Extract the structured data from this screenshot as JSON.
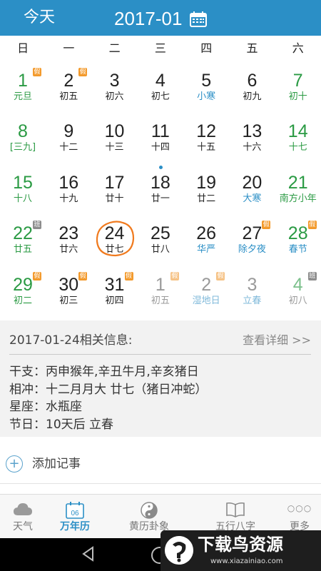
{
  "header": {
    "today_label": "今天",
    "month": "2017-01",
    "calendar_icon": "calendar-icon"
  },
  "weekdays": [
    "日",
    "一",
    "二",
    "三",
    "四",
    "五",
    "六"
  ],
  "colors": {
    "accent": "#2b8fc6",
    "green": "#2a9a43",
    "rest_badge": "#f39a2c",
    "work_badge": "#8d8d8d"
  },
  "calendar": {
    "selected_day": "24",
    "weeks": [
      [
        {
          "day": "1",
          "lunar": "元旦",
          "style": "green",
          "lunar_style": "green",
          "badge": "假",
          "badge_type": "rest"
        },
        {
          "day": "2",
          "lunar": "初五",
          "badge": "假",
          "badge_type": "rest"
        },
        {
          "day": "3",
          "lunar": "初六"
        },
        {
          "day": "4",
          "lunar": "初七"
        },
        {
          "day": "5",
          "lunar": "小寒",
          "lunar_style": "blue"
        },
        {
          "day": "6",
          "lunar": "初九"
        },
        {
          "day": "7",
          "lunar": "初十",
          "style": "green",
          "lunar_style": "green"
        }
      ],
      [
        {
          "day": "8",
          "lunar": "[三九]",
          "style": "green",
          "lunar_style": "green"
        },
        {
          "day": "9",
          "lunar": "十二"
        },
        {
          "day": "10",
          "lunar": "十三"
        },
        {
          "day": "11",
          "lunar": "十四"
        },
        {
          "day": "12",
          "lunar": "十五"
        },
        {
          "day": "13",
          "lunar": "十六"
        },
        {
          "day": "14",
          "lunar": "十七",
          "style": "green",
          "lunar_style": "green"
        }
      ],
      [
        {
          "day": "15",
          "lunar": "十八",
          "style": "green",
          "lunar_style": "green"
        },
        {
          "day": "16",
          "lunar": "十九"
        },
        {
          "day": "17",
          "lunar": "廿十"
        },
        {
          "day": "18",
          "lunar": "廿一",
          "dot": true
        },
        {
          "day": "19",
          "lunar": "廿二"
        },
        {
          "day": "20",
          "lunar": "大寒",
          "lunar_style": "blue"
        },
        {
          "day": "21",
          "lunar": "南方小年",
          "style": "green",
          "lunar_style": "green"
        }
      ],
      [
        {
          "day": "22",
          "lunar": "廿五",
          "style": "green",
          "lunar_style": "green",
          "badge": "班",
          "badge_type": "work"
        },
        {
          "day": "23",
          "lunar": "廿六"
        },
        {
          "day": "24",
          "lunar": "廿七",
          "today": true
        },
        {
          "day": "25",
          "lunar": "廿八"
        },
        {
          "day": "26",
          "lunar": "华严",
          "lunar_style": "blue"
        },
        {
          "day": "27",
          "lunar": "除夕夜",
          "lunar_style": "blue",
          "badge": "假",
          "badge_type": "rest"
        },
        {
          "day": "28",
          "lunar": "春节",
          "style": "green",
          "lunar_style": "blue",
          "badge": "假",
          "badge_type": "rest"
        }
      ],
      [
        {
          "day": "29",
          "lunar": "初二",
          "style": "green",
          "lunar_style": "green",
          "badge": "假",
          "badge_type": "rest"
        },
        {
          "day": "30",
          "lunar": "初三",
          "badge": "假",
          "badge_type": "rest"
        },
        {
          "day": "31",
          "lunar": "初四",
          "badge": "假",
          "badge_type": "rest"
        },
        {
          "day": "1",
          "lunar": "初五",
          "style": "faded",
          "lunar_style": "faded",
          "badge": "假",
          "badge_type": "rest faded"
        },
        {
          "day": "2",
          "lunar": "湿地日",
          "style": "faded",
          "lunar_style": "faded-blue",
          "badge": "假",
          "badge_type": "rest faded"
        },
        {
          "day": "3",
          "lunar": "立春",
          "style": "faded",
          "lunar_style": "faded-blue"
        },
        {
          "day": "4",
          "lunar": "初八",
          "style": "faded-green",
          "lunar_style": "faded",
          "badge": "班",
          "badge_type": "work"
        }
      ]
    ]
  },
  "info": {
    "title": "2017-01-24相关信息:",
    "more": "查看详细 >>",
    "rows": [
      "干支：丙申猴年,辛丑牛月,辛亥猪日",
      "相冲：十二月月大 廿七（猪日冲蛇）",
      "星座：水瓶座",
      "节日：10天后 立春"
    ]
  },
  "add_note": {
    "icon": "+",
    "label": "添加记事"
  },
  "tabs": [
    {
      "label": "天气",
      "icon": "cloud-icon"
    },
    {
      "label": "万年历",
      "icon": "calendar-06-icon",
      "icon_text": "06",
      "active": true
    },
    {
      "label": "黄历卦象",
      "icon": "yin-yang-icon"
    },
    {
      "label": "五行八字",
      "icon": "book-icon"
    },
    {
      "label": "更多",
      "icon": "more-dots-icon",
      "icon_text": "○○○"
    }
  ],
  "watermark": {
    "text": "下载鸟资源",
    "url": "www.xiazainiao.com"
  }
}
